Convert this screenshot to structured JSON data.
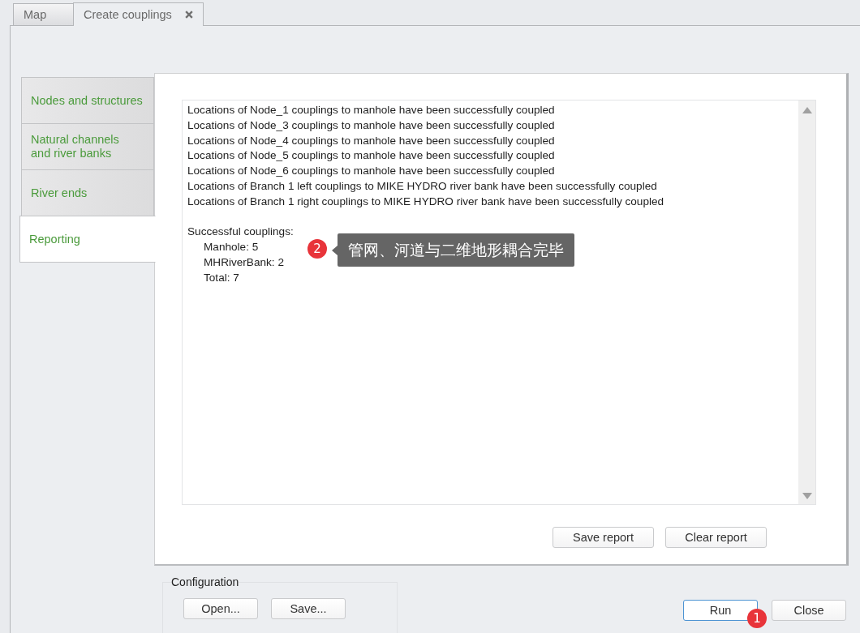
{
  "tabs": [
    {
      "label": "Map",
      "selected": false,
      "closable": false
    },
    {
      "label": "Create couplings",
      "selected": true,
      "closable": true
    }
  ],
  "side_tabs": [
    {
      "label": "Nodes and structures",
      "selected": false
    },
    {
      "label": "Natural channels\nand river banks",
      "selected": false
    },
    {
      "label": "River ends",
      "selected": false
    },
    {
      "label": "Reporting",
      "selected": true
    }
  ],
  "report": {
    "lines": [
      "Locations of Node_1 couplings to manhole have been successfully coupled",
      "Locations of Node_3 couplings to manhole have been successfully coupled",
      "Locations of Node_4 couplings to manhole have been successfully coupled",
      "Locations of Node_5 couplings to manhole have been successfully coupled",
      "Locations of Node_6 couplings to manhole have been successfully coupled",
      "Locations of Branch 1 left couplings to MIKE HYDRO river bank have been successfully coupled",
      "Locations of Branch 1 right couplings to MIKE HYDRO river bank have been successfully coupled"
    ],
    "summary_title": "Successful couplings:",
    "summary_items": [
      "Manhole: 5",
      "MHRiverBank: 2",
      "Total: 7"
    ],
    "callout": {
      "badge": "2",
      "text": "管网、河道与二维地形耦合完毕"
    },
    "buttons": [
      "Save report",
      "Clear report"
    ]
  },
  "configuration": {
    "title": "Configuration",
    "buttons": [
      "Open...",
      "Save..."
    ]
  },
  "dialog_buttons": [
    {
      "label": "Run",
      "focused": true,
      "badge": "1"
    },
    {
      "label": "Close",
      "focused": false
    }
  ]
}
